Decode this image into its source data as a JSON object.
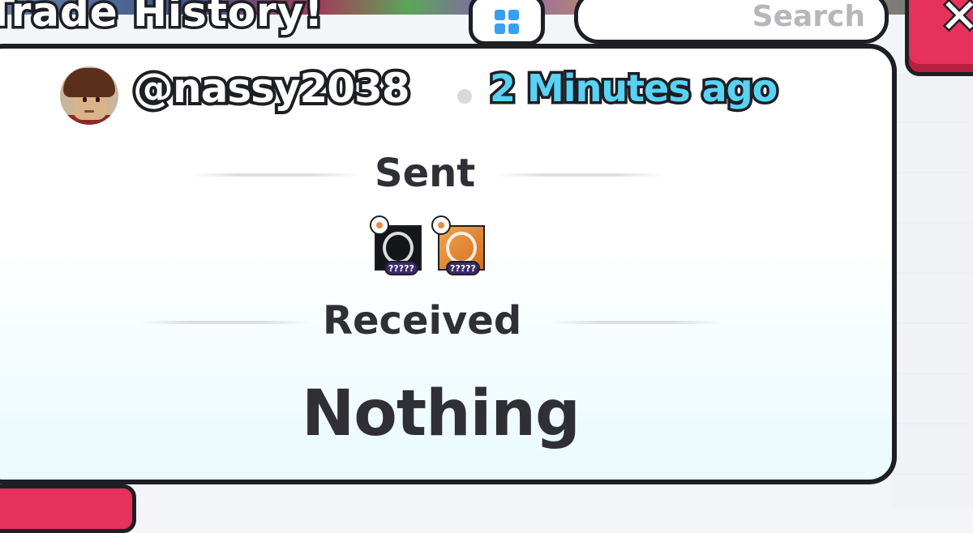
{
  "window": {
    "title": "Trade History!",
    "menu_icon": "grid-icon",
    "close_icon": "close-icon"
  },
  "search": {
    "placeholder": "Search",
    "value": ""
  },
  "trade": {
    "avatar_icon": "user-avatar",
    "username": "@nassy2038",
    "time": "2 Minutes ago",
    "sent_label": "Sent",
    "sent_items": [
      {
        "icon": "pet-card-black",
        "badge": "?????"
      },
      {
        "icon": "pet-card-orange",
        "badge": "?????"
      }
    ],
    "received_label": "Received",
    "received_value": "Nothing"
  },
  "colors": {
    "accent_red": "#e5315b",
    "time_blue": "#58d3f5",
    "icon_blue": "#38a0f2",
    "outline": "#1d1f24"
  }
}
